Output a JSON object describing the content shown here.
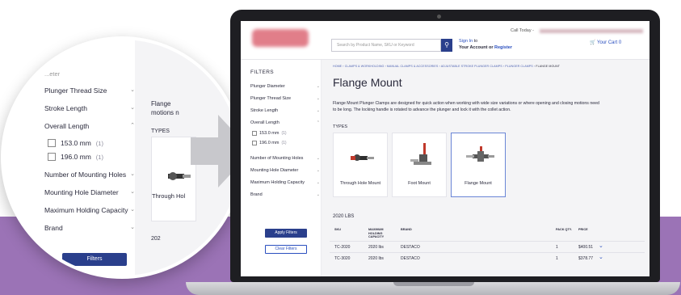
{
  "site": {
    "call_today": "Call Today -",
    "search_placeholder": "Search by Product Name, SKU or Keyword",
    "signin_link": "Sign In",
    "signin_to": " to",
    "account_prefix": "Your Account or ",
    "register_link": "Register",
    "cart_label": "Your Cart",
    "cart_count": "0"
  },
  "breadcrumb": [
    "HOME",
    "CLAMPS & WORKHOLDING",
    "MANUAL CLAMPS & ACCESSORIES",
    "ADJUSTABLE STROKE PLUNGER CLAMPS",
    "PLUNGER CLAMPS",
    "FLANGE MOUNT"
  ],
  "filters": {
    "title": "FILTERS",
    "items": [
      {
        "label": "Plunger Diameter",
        "expanded": false
      },
      {
        "label": "Plunger Thread Size",
        "expanded": false
      },
      {
        "label": "Stroke Length",
        "expanded": false
      },
      {
        "label": "Overall Length",
        "expanded": true
      },
      {
        "label": "Number of Mounting Holes",
        "expanded": false
      },
      {
        "label": "Mounting Hole Diameter",
        "expanded": false
      },
      {
        "label": "Maximum Holding Capacity",
        "expanded": false
      },
      {
        "label": "Brand",
        "expanded": false
      }
    ],
    "overall_length_options": [
      {
        "label": "153.0 mm",
        "count": "(1)"
      },
      {
        "label": "196.0 mm",
        "count": "(1)"
      }
    ],
    "apply_label": "Apply Filters",
    "clear_label": "Clear Filters"
  },
  "page": {
    "title": "Flange Mount",
    "description": "Flange Mount Plunger Clamps are designed for quick action when working with wide size variations or where opening and closing motions need to be long. The locking handle is rotated to advance the plunger and lock it with the collet action.",
    "types_label": "TYPES",
    "types": [
      "Through Hole Mount",
      "Foot Mount",
      "Flange Mount"
    ],
    "selected_type": "Flange Mount",
    "section_title": "2020 LBS"
  },
  "table": {
    "headers": {
      "sku": "SKU",
      "capacity": "MAXIMUM HOLDING CAPACITY",
      "brand": "BRAND",
      "pack": "PACK QTY.",
      "price": "PRICE"
    },
    "rows": [
      {
        "sku": "TC-2020",
        "capacity": "2020 lbs",
        "brand": "DESTACO",
        "pack": "1",
        "price": "$400.51"
      },
      {
        "sku": "TC-3020",
        "capacity": "2020 lbs",
        "brand": "DESTACO",
        "pack": "1",
        "price": "$378.77"
      }
    ]
  },
  "zoom": {
    "partial_heading": "...eter",
    "items": [
      "Plunger Thread Size",
      "Stroke Length",
      "Overall Length",
      "Number of Mounting Holes",
      "Mounting Hole Diameter",
      "Maximum Holding Capacity",
      "Brand"
    ],
    "options": [
      {
        "label": "153.0 mm",
        "count": "(1)"
      },
      {
        "label": "196.0 mm",
        "count": "(1)"
      }
    ],
    "right_text_1": "Flange",
    "right_text_2": "motions n",
    "types_label": "TYPES",
    "card_label": "Through Hol",
    "year_fragment": "202",
    "apply_fragment": "Filters"
  },
  "colors": {
    "brand_blue": "#2a3f8c",
    "link_blue": "#2a4fbf",
    "band_purple": "#9b73b6",
    "laptop_frame": "#1e1e22"
  }
}
